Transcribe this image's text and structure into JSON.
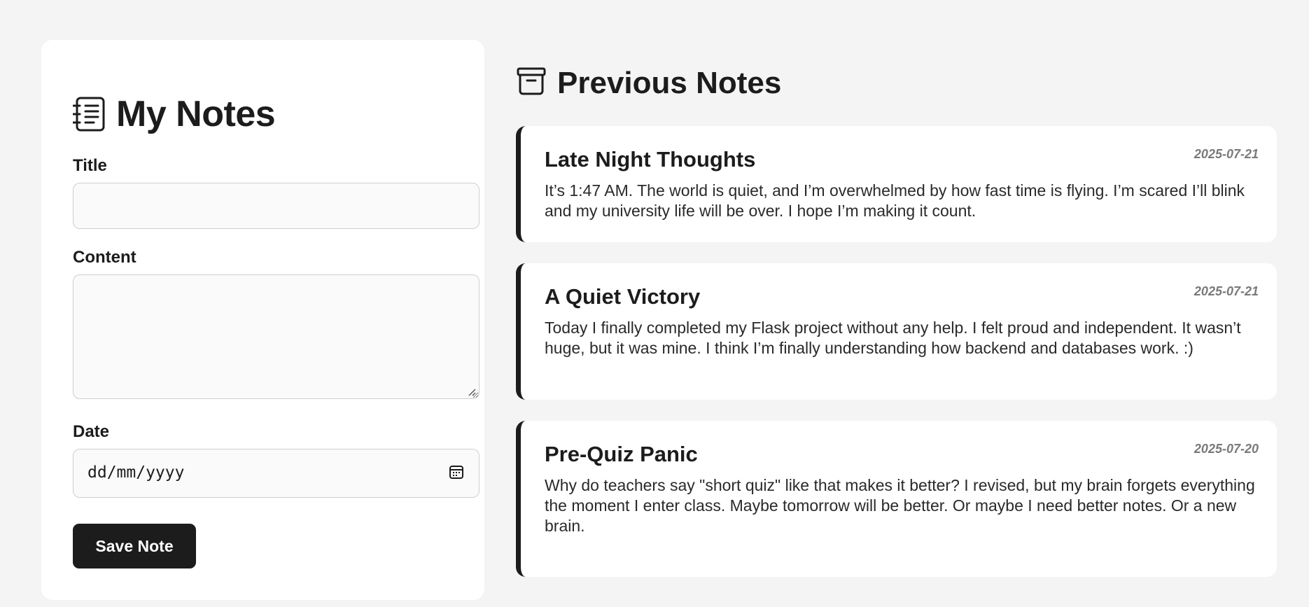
{
  "form": {
    "title": "My Notes",
    "icon": "notebook-icon",
    "title_label": "Title",
    "title_value": "",
    "content_label": "Content",
    "content_value": "",
    "date_label": "Date",
    "date_placeholder": "dd/mm/yyyy",
    "calendar_icon": "calendar-icon",
    "save_label": "Save Note"
  },
  "notes_section": {
    "title": "Previous Notes",
    "icon": "archive-box-icon"
  },
  "notes": [
    {
      "title": "Late Night Thoughts",
      "date": "2025-07-21",
      "content": "It’s 1:47 AM. The world is quiet, and I’m overwhelmed by how fast time is flying. I’m scared I’ll blink and my university life will be over. I hope I’m making it count."
    },
    {
      "title": "A Quiet Victory",
      "date": "2025-07-21",
      "content": "Today I finally completed my Flask project without any help. I felt proud and independent. It wasn’t huge, but it was mine. I think I’m finally understanding how backend and databases work. :)"
    },
    {
      "title": "Pre-Quiz Panic",
      "date": "2025-07-20",
      "content": "Why do teachers say \"short quiz\" like that makes it better? I revised, but my brain forgets everything the moment I enter class. Maybe tomorrow will be better. Or maybe I need better notes. Or a new brain."
    }
  ],
  "colors": {
    "background": "#f4f4f4",
    "panel": "#ffffff",
    "accent": "#1c1c1c",
    "date_text": "#7a7a7a"
  }
}
